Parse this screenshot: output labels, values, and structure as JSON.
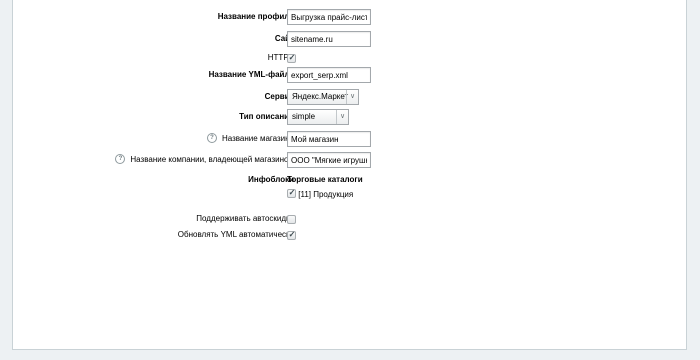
{
  "form": {
    "profile_name": {
      "label": "Название профиля",
      "value": "Выгрузка прайс-листа"
    },
    "site": {
      "label": "Сайт",
      "value": "sitename.ru"
    },
    "https": {
      "label": "HTTPS",
      "checked": true
    },
    "yml_file": {
      "label": "Название YML-файла",
      "value": "export_serp.xml"
    },
    "service": {
      "label": "Сервис",
      "value": "Яндекс.Маркет"
    },
    "description_type": {
      "label": "Тип описаний",
      "value": "simple"
    },
    "shop_name": {
      "label": "Название магазина",
      "value": "Мой магазин",
      "help_icon": "help-icon"
    },
    "company_name": {
      "label": "Название компании, владеющей магазином",
      "value": "ООО \"Мягкие игрушки\"",
      "help_icon": "help-icon"
    },
    "infoblocks": {
      "label": "Инфоблоки",
      "group_title": "Торговые каталоги",
      "items": [
        {
          "label": "[11] Продукция",
          "checked": true
        }
      ]
    },
    "auto_discounts": {
      "label": "Поддерживать автоскидки",
      "checked": false
    },
    "auto_update": {
      "label": "Обновлять YML автоматически",
      "checked": true
    }
  },
  "colors": {
    "page_background": "#edf1f3",
    "panel_background": "#ffffff",
    "input_border": "#a3a8ac"
  }
}
